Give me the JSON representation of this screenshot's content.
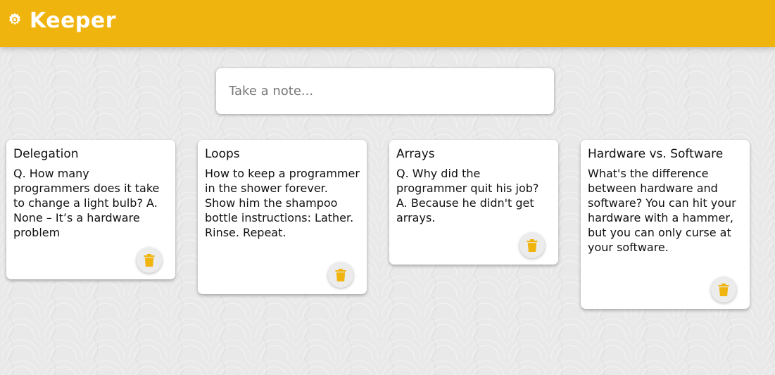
{
  "app": {
    "title": "Keeper",
    "logo_icon": "gear-icon",
    "accent_color": "#f0b40f"
  },
  "create_note": {
    "placeholder": "Take a note..."
  },
  "notes": [
    {
      "title": "Delegation",
      "content": "Q. How many programmers does it take to change a light bulb? A. None – It’s a hardware problem",
      "delete_icon": "trash-icon"
    },
    {
      "title": "Loops",
      "content": "How to keep a programmer in the shower forever. Show him the shampoo bottle instructions: Lather. Rinse. Repeat.",
      "delete_icon": "trash-icon"
    },
    {
      "title": "Arrays",
      "content": "Q. Why did the programmer quit his job? A. Because he didn't get arrays.",
      "delete_icon": "trash-icon"
    },
    {
      "title": "Hardware vs. Software",
      "content": "What's the difference between hardware and software? You can hit your hardware with a hammer, but you can only curse at your software.",
      "delete_icon": "trash-icon"
    }
  ]
}
